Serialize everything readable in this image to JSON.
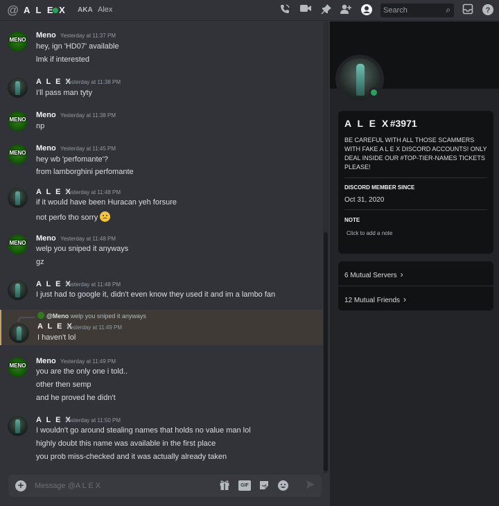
{
  "header": {
    "dm_name": "A L E X",
    "aka_label": "AKA",
    "aka_name": "Alex",
    "search_placeholder": "Search",
    "icons": [
      "at-sign-icon",
      "voice-call-icon",
      "video-call-icon",
      "pin-icon",
      "add-friend-icon",
      "profile-toggle-icon",
      "search-icon",
      "inbox-icon",
      "help-icon"
    ],
    "status_color": "#23a55a"
  },
  "messages": [
    {
      "author": "Meno",
      "timestamp": "Yesterday at 11:37 PM",
      "lines": [
        "hey, ign 'HD07' available",
        "lmk if interested"
      ]
    },
    {
      "author": "A L E X",
      "timestamp": "Yesterday at 11:38 PM",
      "lines": [
        "I'll pass man tyty"
      ]
    },
    {
      "author": "Meno",
      "timestamp": "Yesterday at 11:38 PM",
      "lines": [
        "np"
      ]
    },
    {
      "author": "Meno",
      "timestamp": "Yesterday at 11:45 PM",
      "lines": [
        "hey wb 'perfomante'?",
        "from lamborghini perfomante"
      ]
    },
    {
      "author": "A L E X",
      "timestamp": "Yesterday at 11:48 PM",
      "lines": [
        "if it would have been Huracan yeh forsure",
        "not perfo tho sorry"
      ]
    },
    {
      "author": "Meno",
      "timestamp": "Yesterday at 11:48 PM",
      "lines": [
        "welp you sniped it anyways",
        "gz"
      ]
    },
    {
      "author": "A L E X",
      "timestamp": "Yesterday at 11:48 PM",
      "lines": [
        "I just had to google it, didn't even know they used it and im a lambo fan"
      ]
    },
    {
      "author": "A L E X",
      "timestamp": "Yesterday at 11:49 PM",
      "reply_to": "@Meno",
      "reply_text": "welp you sniped it anyways",
      "lines": [
        "I haven't lol"
      ]
    },
    {
      "author": "Meno",
      "timestamp": "Yesterday at 11:49 PM",
      "lines": [
        "you are the only one i told..",
        "other then semp",
        "and he proved he didn't"
      ]
    },
    {
      "author": "A L E X",
      "timestamp": "Yesterday at 11:50 PM",
      "lines": [
        "I wouldn't go around stealing names that holds no value man lol",
        "highly doubt this name was available in the first place",
        "you prob miss-checked and it was actually already taken"
      ]
    }
  ],
  "meno_avatar_text": "MENO",
  "composer": {
    "placeholder": "Message @A L E X",
    "gif_label": "GIF"
  },
  "profile": {
    "name": "A L E X",
    "discriminator": "#3971",
    "bio": "BE CAREFUL WITH ALL THOSE SCAMMERS WITH FAKE A L E X DISCORD ACCOUNTS! ONLY DEAL INSIDE OUR #TOP-TIER-NAMES TICKETS PLEASE!",
    "member_since_label": "DISCORD MEMBER SINCE",
    "member_since": "Oct 31, 2020",
    "note_label": "NOTE",
    "note_placeholder": "Click to add a note",
    "mutual_servers": "6 Mutual Servers",
    "mutual_friends": "12 Mutual Friends"
  }
}
